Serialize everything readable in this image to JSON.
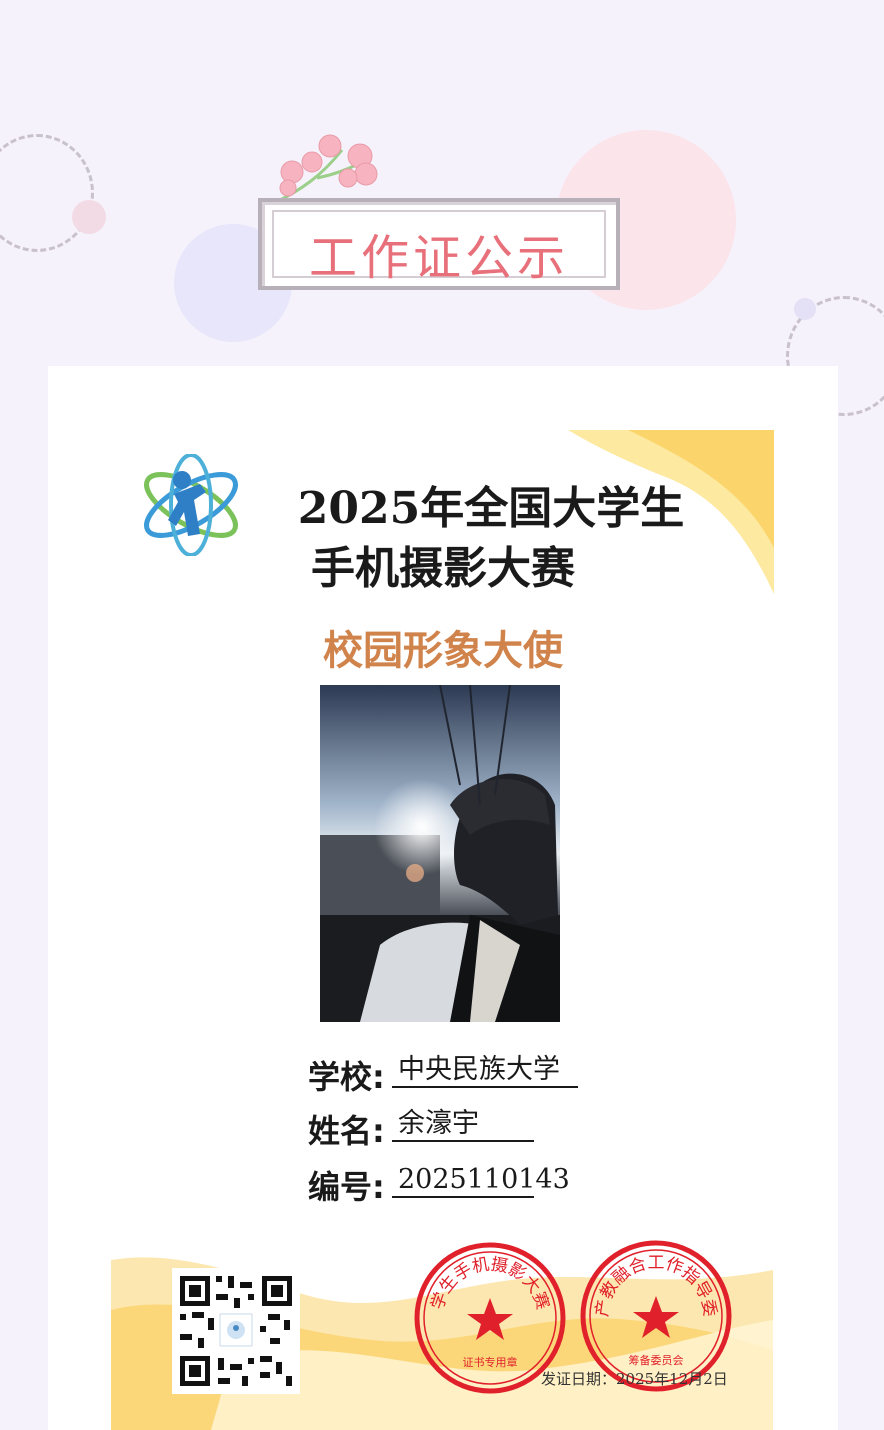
{
  "banner": {
    "title": "工作证公示"
  },
  "competition": {
    "title_line1": "2025年全国大学生",
    "title_line2": "手机摄影大赛",
    "role": "校园形象大使"
  },
  "fields": [
    {
      "label": "学校:",
      "value": "中央民族大学"
    },
    {
      "label": "姓名:",
      "value": "余濠宇"
    },
    {
      "label": "编号:",
      "value": "2025110143"
    }
  ],
  "seals": [
    {
      "ring_text": "全国大学生手机摄影大赛组委会",
      "bottom_text": "证书专用章"
    },
    {
      "ring_text": "全国产教融合工作指导委员会",
      "bottom_text": "筹备委员会"
    }
  ],
  "issue_date": "发证日期：2025年12月2日",
  "colors": {
    "accent": "#e8707a",
    "role": "#d0834a",
    "seal": "#e0202a"
  }
}
